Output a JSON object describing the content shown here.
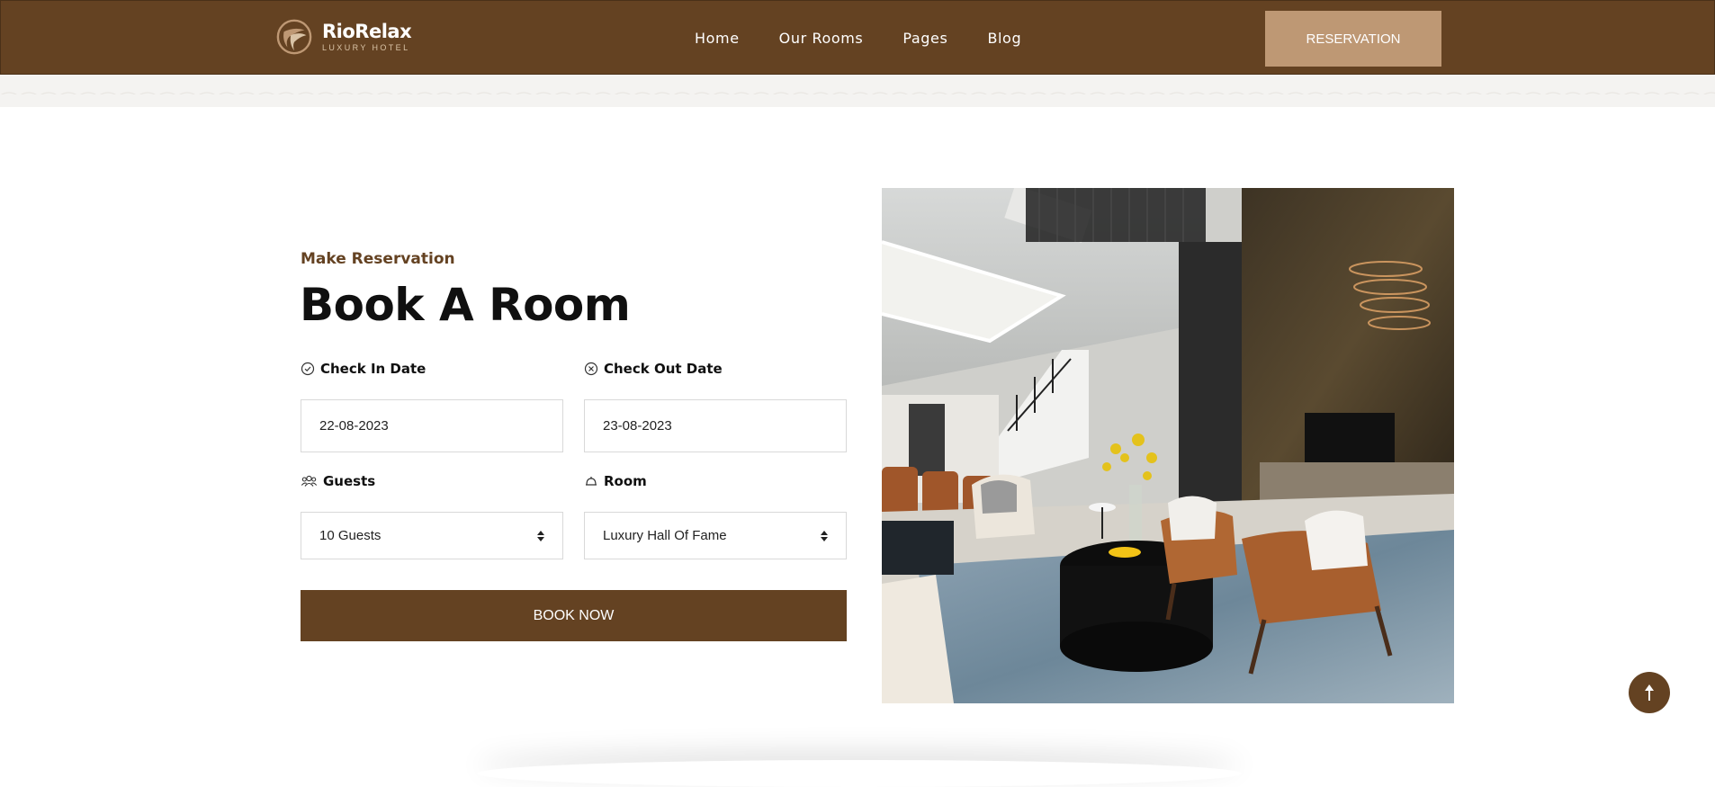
{
  "header": {
    "brand": {
      "name": "RioRelax",
      "tagline": "LUXURY HOTEL"
    },
    "nav": [
      {
        "label": "Home"
      },
      {
        "label": "Our Rooms"
      },
      {
        "label": "Pages"
      },
      {
        "label": "Blog"
      }
    ],
    "cta_label": "RESERVATION"
  },
  "booking": {
    "eyebrow": "Make Reservation",
    "title": "Book A Room",
    "check_in": {
      "label": "Check In Date",
      "value": "22-08-2023",
      "icon": "check-circle-icon"
    },
    "check_out": {
      "label": "Check Out Date",
      "value": "23-08-2023",
      "icon": "x-circle-icon"
    },
    "guests": {
      "label": "Guests",
      "value": "10 Guests",
      "icon": "users-icon"
    },
    "room": {
      "label": "Room",
      "value": "Luxury Hall Of Fame",
      "icon": "bell-icon"
    },
    "submit_label": "BOOK NOW"
  },
  "colors": {
    "brand_brown": "#644222",
    "accent_tan": "#be9874"
  }
}
